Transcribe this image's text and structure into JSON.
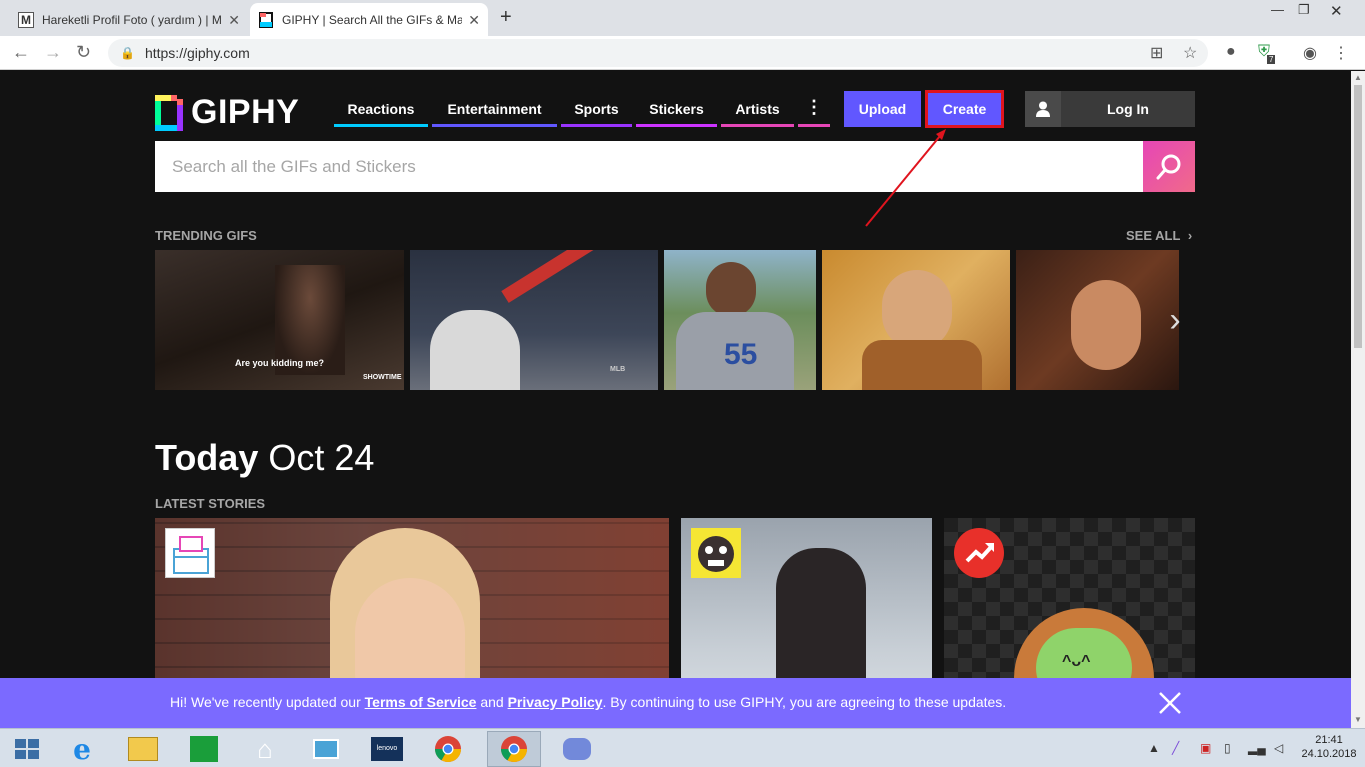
{
  "browser": {
    "tabs": [
      {
        "title": "Hareketli Profil Foto ( yardım ) | M",
        "favicon": "M",
        "active": false
      },
      {
        "title": "GIPHY | Search All the GIFs & Ma",
        "favicon": "gif-icon",
        "active": true
      }
    ],
    "url": "https://giphy.com",
    "profile_badge": "7"
  },
  "giphy": {
    "logo_text": "GIPHY",
    "nav": [
      {
        "label": "Reactions",
        "color": "#00ccff"
      },
      {
        "label": "Entertainment",
        "color": "#9933ff"
      },
      {
        "label": "Sports",
        "color": "#a33bff"
      },
      {
        "label": "Stickers",
        "color": "#cc33ff"
      },
      {
        "label": "Artists",
        "color": "#e646b6"
      }
    ],
    "upload_label": "Upload",
    "create_label": "Create",
    "login_label": "Log In",
    "search_placeholder": "Search all the GIFs and Stickers",
    "trending_label": "TRENDING GIFS",
    "see_all_label": "SEE ALL",
    "trending": [
      {
        "caption": "Are you kidding me?",
        "watermark": "SHOWTIME"
      },
      {
        "caption": "",
        "watermark": "MLB"
      },
      {
        "caption": "",
        "watermark": ""
      },
      {
        "caption": "",
        "watermark": ""
      },
      {
        "caption": "",
        "watermark": ""
      }
    ],
    "today_bold": "Today",
    "today_date": "Oct 24",
    "latest_label": "LATEST STORIES"
  },
  "banner": {
    "prefix": "Hi! We've recently updated our ",
    "tos": "Terms of Service",
    "and": " and ",
    "privacy": "Privacy Policy",
    "suffix": ". By continuing to use GIPHY, you are agreeing to these updates."
  },
  "taskbar": {
    "time": "21:41",
    "date": "24.10.2018"
  },
  "colors": {
    "accent": "#6157ff",
    "highlight": "#e0141e",
    "background": "#121212"
  }
}
